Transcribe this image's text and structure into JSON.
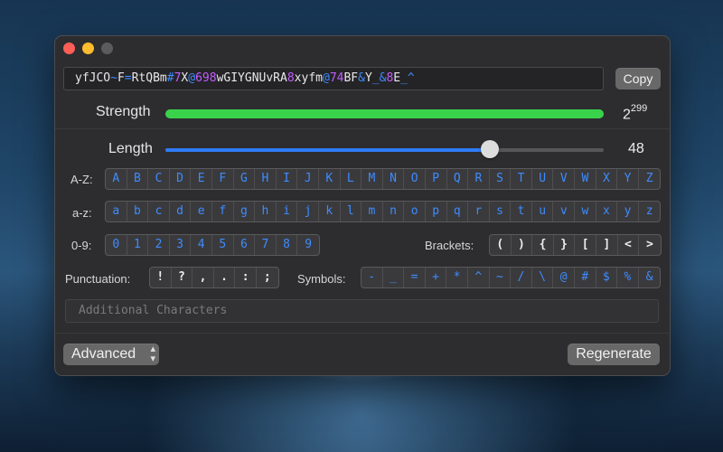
{
  "password": {
    "segments": [
      {
        "text": "yfJCO",
        "color": "#e8e8ea"
      },
      {
        "text": "~",
        "color": "#3e8bff"
      },
      {
        "text": "F",
        "color": "#e8e8ea"
      },
      {
        "text": "=",
        "color": "#3e8bff"
      },
      {
        "text": "RtQBm",
        "color": "#e8e8ea"
      },
      {
        "text": "#",
        "color": "#3e8bff"
      },
      {
        "text": "7",
        "color": "#c35cff"
      },
      {
        "text": "X",
        "color": "#e8e8ea"
      },
      {
        "text": "@",
        "color": "#3e8bff"
      },
      {
        "text": "698",
        "color": "#c35cff"
      },
      {
        "text": "wGIYGNUvRA",
        "color": "#e8e8ea"
      },
      {
        "text": "8",
        "color": "#c35cff"
      },
      {
        "text": "xyfm",
        "color": "#e8e8ea"
      },
      {
        "text": "@",
        "color": "#3e8bff"
      },
      {
        "text": "74",
        "color": "#c35cff"
      },
      {
        "text": "BF",
        "color": "#e8e8ea"
      },
      {
        "text": "&",
        "color": "#3e8bff"
      },
      {
        "text": "Y",
        "color": "#e8e8ea"
      },
      {
        "text": "_&",
        "color": "#3e8bff"
      },
      {
        "text": "8",
        "color": "#c35cff"
      },
      {
        "text": "E",
        "color": "#e8e8ea"
      },
      {
        "text": "_^",
        "color": "#3e8bff"
      }
    ]
  },
  "copy_label": "Copy",
  "strength": {
    "label": "Strength",
    "base": "2",
    "exponent": "299",
    "fill_fraction": 1.0,
    "color": "#39d24b"
  },
  "length": {
    "label": "Length",
    "value": "48",
    "fraction": 0.74
  },
  "uppercase": {
    "label": "A-Z:",
    "chars": [
      "A",
      "B",
      "C",
      "D",
      "E",
      "F",
      "G",
      "H",
      "I",
      "J",
      "K",
      "L",
      "M",
      "N",
      "O",
      "P",
      "Q",
      "R",
      "S",
      "T",
      "U",
      "V",
      "W",
      "X",
      "Y",
      "Z"
    ]
  },
  "lowercase": {
    "label": "a-z:",
    "chars": [
      "a",
      "b",
      "c",
      "d",
      "e",
      "f",
      "g",
      "h",
      "i",
      "j",
      "k",
      "l",
      "m",
      "n",
      "o",
      "p",
      "q",
      "r",
      "s",
      "t",
      "u",
      "v",
      "w",
      "x",
      "y",
      "z"
    ]
  },
  "digits": {
    "label": "0-9:",
    "chars": [
      "0",
      "1",
      "2",
      "3",
      "4",
      "5",
      "6",
      "7",
      "8",
      "9"
    ]
  },
  "brackets": {
    "label": "Brackets:",
    "chars": [
      "(",
      ")",
      "{",
      "}",
      "[",
      "]",
      "<",
      ">"
    ]
  },
  "punctuation": {
    "label": "Punctuation:",
    "chars": [
      "!",
      "?",
      ",",
      ".",
      ":",
      ";"
    ]
  },
  "symbols": {
    "label": "Symbols:",
    "chars": [
      "-",
      "_",
      "=",
      "+",
      "*",
      "^",
      "~",
      "/",
      "\\",
      "@",
      "#",
      "$",
      "%",
      "&"
    ]
  },
  "additional": {
    "placeholder": "Additional Characters"
  },
  "advanced_label": "Advanced",
  "regenerate_label": "Regenerate",
  "colors": {
    "accent_blue": "#3e8bff",
    "digit_purple": "#c35cff",
    "strength_green": "#39d24b"
  }
}
